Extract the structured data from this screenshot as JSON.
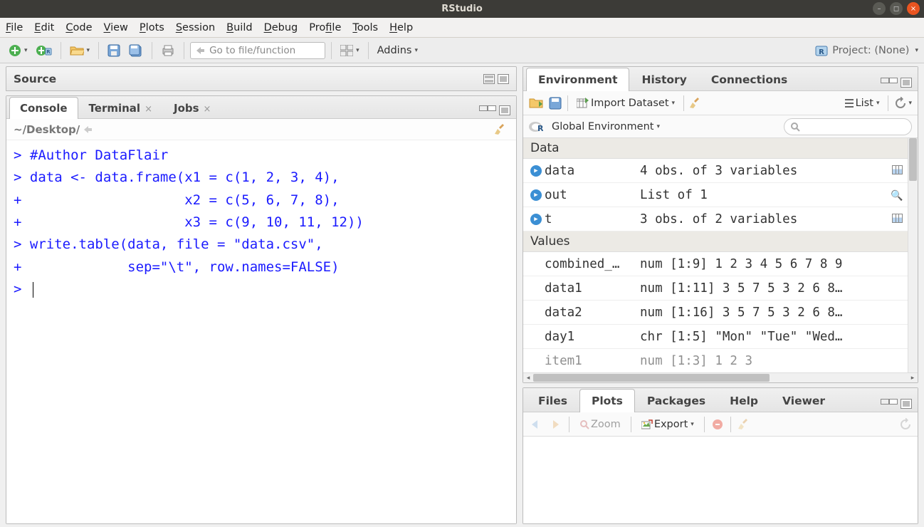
{
  "window": {
    "title": "RStudio"
  },
  "menubar": [
    "File",
    "Edit",
    "Code",
    "View",
    "Plots",
    "Session",
    "Build",
    "Debug",
    "Profile",
    "Tools",
    "Help"
  ],
  "toolbar": {
    "goto_placeholder": "Go to file/function",
    "addins": "Addins",
    "project": "Project: (None)"
  },
  "source": {
    "title": "Source"
  },
  "console": {
    "tabs": [
      "Console",
      "Terminal",
      "Jobs"
    ],
    "active_tab": 0,
    "path": "~/Desktop/",
    "lines": [
      "> #Author DataFlair",
      "> data <- data.frame(x1 = c(1, 2, 3, 4),",
      "+                    x2 = c(5, 6, 7, 8),",
      "+                    x3 = c(9, 10, 11, 12))",
      "> write.table(data, file = \"data.csv\",",
      "+             sep=\"\\t\", row.names=FALSE)",
      "> "
    ]
  },
  "environment": {
    "tabs": [
      "Environment",
      "History",
      "Connections"
    ],
    "active_tab": 0,
    "import_label": "Import Dataset",
    "list_label": "List",
    "scope": "Global Environment",
    "sections": {
      "data_label": "Data",
      "values_label": "Values"
    },
    "data_rows": [
      {
        "name": "data",
        "value": "4 obs. of 3 variables",
        "action": "grid"
      },
      {
        "name": "out",
        "value": "List of 1",
        "action": "search"
      },
      {
        "name": "t",
        "value": "3 obs. of 2 variables",
        "action": "grid"
      }
    ],
    "value_rows": [
      {
        "name": "combined_…",
        "value": "num [1:9] 1 2 3 4 5 6 7 8 9"
      },
      {
        "name": "data1",
        "value": "num [1:11] 3 5 7 5 3 2 6 8…"
      },
      {
        "name": "data2",
        "value": "num [1:16] 3 5 7 5 3 2 6 8…"
      },
      {
        "name": "day1",
        "value": "chr [1:5] \"Mon\" \"Tue\" \"Wed…"
      },
      {
        "name": "item1",
        "value": "num [1:3] 1 2 3"
      }
    ]
  },
  "plots": {
    "tabs": [
      "Files",
      "Plots",
      "Packages",
      "Help",
      "Viewer"
    ],
    "active_tab": 1,
    "zoom_label": "Zoom",
    "export_label": "Export"
  }
}
